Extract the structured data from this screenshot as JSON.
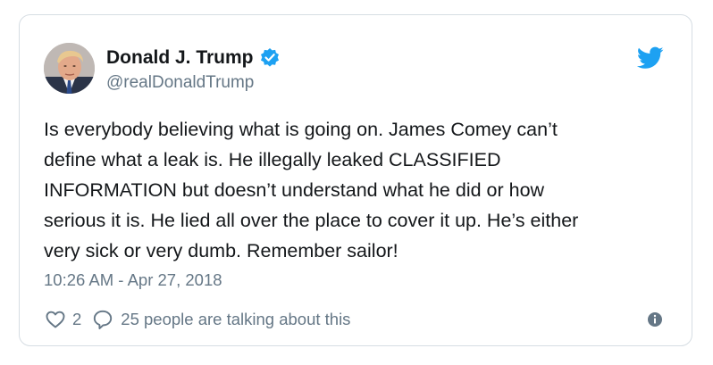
{
  "author": {
    "name": "Donald J. Trump",
    "handle": "@realDonaldTrump",
    "verified": true,
    "avatar_icon": "profile-photo"
  },
  "tweet": {
    "text": "Is everybody believing what is going on. James Comey can’t\ndefine what a leak is. He illegally leaked CLASSIFIED\nINFORMATION but doesn’t understand what he did or how\nserious it is. He lied all over the place to cover it up. He’s either\nvery sick or very dumb. Remember sailor!",
    "timestamp": "10:26 AM - Apr 27, 2018"
  },
  "actions": {
    "like_count": "2",
    "talking_text": "25 people are talking about this"
  },
  "icons": {
    "brand": "twitter-bird-icon",
    "verified": "verified-badge-icon",
    "like": "heart-icon",
    "reply": "reply-bubble-icon",
    "info": "info-icon"
  },
  "colors": {
    "brand_blue": "#1da1f2",
    "text_primary": "#14171a",
    "text_secondary": "#657786",
    "border": "#d6dde3"
  }
}
